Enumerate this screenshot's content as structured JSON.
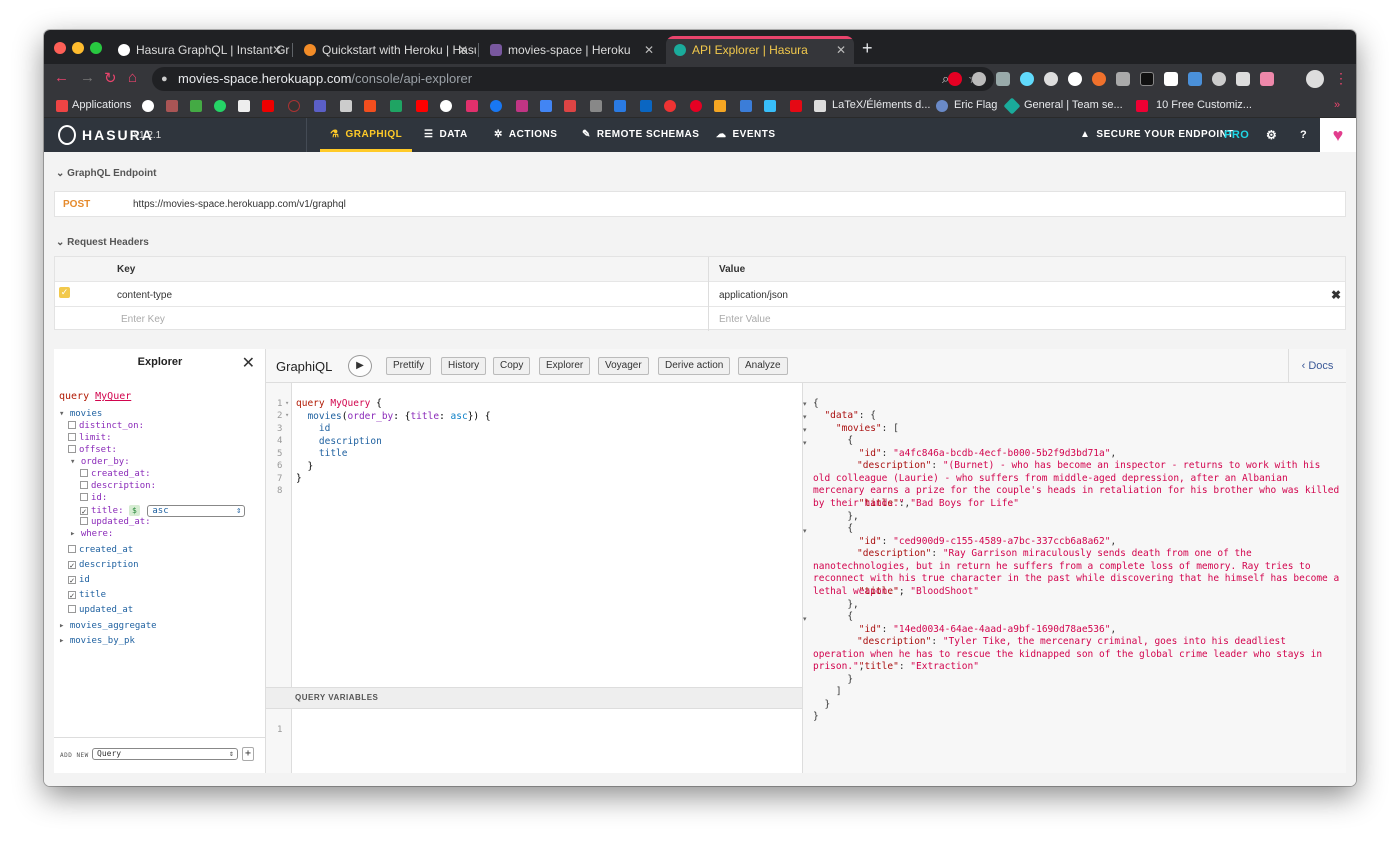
{
  "browser": {
    "tabs": [
      {
        "title": "Hasura GraphQL | Instant Grap",
        "close": "✕"
      },
      {
        "title": "Quickstart with Heroku | Hasur",
        "close": "✕"
      },
      {
        "title": "movies-space | Heroku",
        "close": "✕"
      },
      {
        "title": "API Explorer | Hasura",
        "close": "✕"
      }
    ],
    "new_tab": "+",
    "url_host": "movies-space.herokuapp.com",
    "url_path": "/console/api-explorer",
    "bookmarks": {
      "apps": "Applications",
      "latex": "LaTeX/Éléments d...",
      "eric": "Eric Flag",
      "general": "General | Team se...",
      "free": "10 Free Customiz...",
      "more": "»"
    }
  },
  "hasura": {
    "brand": "HASURA",
    "version": "v1.2.1",
    "nav": [
      {
        "label": "GRAPHIQL",
        "icon": "flask-icon"
      },
      {
        "label": "DATA",
        "icon": "database-icon"
      },
      {
        "label": "ACTIONS",
        "icon": "cogs-icon"
      },
      {
        "label": "REMOTE SCHEMAS",
        "icon": "plug-icon"
      },
      {
        "label": "EVENTS",
        "icon": "cloud-icon"
      }
    ],
    "secure": "SECURE YOUR ENDPOINT",
    "pro": "PRO",
    "settings": "⚙",
    "help": "?"
  },
  "endpoint": {
    "section": "GraphQL Endpoint",
    "method": "POST",
    "url": "https://movies-space.herokuapp.com/v1/graphql"
  },
  "headers": {
    "section": "Request Headers",
    "col_key": "Key",
    "col_value": "Value",
    "rows": [
      {
        "key": "content-type",
        "value": "application/json",
        "checked": true
      }
    ],
    "key_placeholder": "Enter Key",
    "value_placeholder": "Enter Value"
  },
  "graphiql": {
    "title": "GraphiQL",
    "buttons": [
      "Prettify",
      "History",
      "Copy",
      "Explorer",
      "Voyager",
      "Derive action",
      "Analyze"
    ],
    "docs": "Docs",
    "query_variables_label": "QUERY VARIABLES"
  },
  "explorer": {
    "title": "Explorer",
    "query_kw": "query",
    "op_name": "MyQuer",
    "root": "movies",
    "args": [
      "distinct_on:",
      "limit:",
      "offset:",
      "order_by:"
    ],
    "order_fields": [
      "created_at:",
      "description:",
      "id:",
      "title:",
      "updated_at:"
    ],
    "asc": "asc",
    "where": "where:",
    "fields": [
      {
        "name": "created_at",
        "checked": false
      },
      {
        "name": "description",
        "checked": true
      },
      {
        "name": "id",
        "checked": true
      },
      {
        "name": "title",
        "checked": true
      },
      {
        "name": "updated_at",
        "checked": false
      }
    ],
    "other_roots": [
      "movies_aggregate",
      "movies_by_pk"
    ],
    "add_new": "ADD NEW",
    "add_type": "Query",
    "add_btn": "+"
  },
  "query_lines": [
    "query MyQuery {",
    "  movies(order_by: {title: asc}) {",
    "    id",
    "    description",
    "    title",
    "  }",
    "}",
    ""
  ],
  "result": {
    "movies": [
      {
        "id": "a4fc846a-bcdb-4ecf-b000-5b2f9d3bd71a",
        "description": "(Burnet) - who has become an inspector - returns to work with his old colleague (Laurie) - who suffers from middle-aged depression, after an Albanian mercenary earns a prize for the couple's heads in retaliation for his brother who was killed by their hands.",
        "title": "Bad Boys for Life"
      },
      {
        "id": "ced900d9-c155-4589-a7bc-337ccb6a8a62",
        "description": "Ray Garrison miraculously sends death from one of the nanotechnologies, but in return he suffers from a complete loss of memory. Ray tries to reconnect with his true character in the past while discovering that he himself has become a lethal weapon.",
        "title": "BloodShoot"
      },
      {
        "id": "14ed0034-64ae-4aad-a9bf-1690d78ae536",
        "description": "Tyler Tike, the mercenary criminal, goes into his deadliest operation when he has to rescue the kidnapped son of the global crime leader who stays in prison.",
        "title": "Extraction"
      }
    ]
  },
  "colors": {
    "hasura_nav": "#2f353d",
    "accent": "#ffca28",
    "pro": "#1fd6e5",
    "json_string": "#d2054e"
  }
}
